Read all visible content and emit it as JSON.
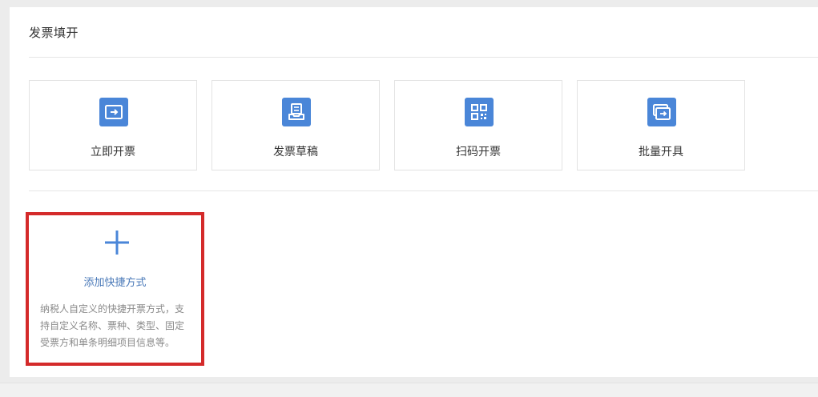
{
  "section": {
    "title": "发票填开"
  },
  "quick_actions": [
    {
      "label": "立即开票",
      "icon": "ticket-arrow-icon"
    },
    {
      "label": "发票草稿",
      "icon": "document-tray-icon"
    },
    {
      "label": "扫码开票",
      "icon": "qr-code-icon"
    },
    {
      "label": "批量开具",
      "icon": "batch-ticket-icon"
    }
  ],
  "add_shortcut": {
    "title": "添加快捷方式",
    "icon": "plus-icon",
    "description": "纳税人自定义的快捷开票方式，支持自定义名称、票种、类型、固定受票方和单条明细项目信息等。"
  },
  "colors": {
    "accent": "#4a86d8",
    "highlight_border": "#d42a2a",
    "link_text": "#4a79b8"
  }
}
